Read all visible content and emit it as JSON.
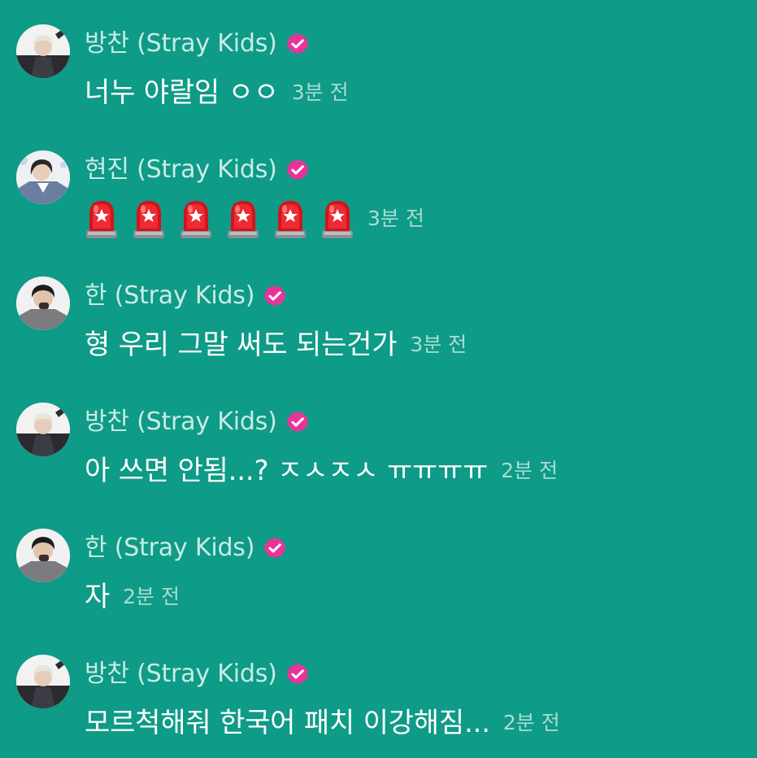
{
  "messages": [
    {
      "author": "방찬 (Stray Kids)",
      "avatar_icon": "user-avatar-bangchan",
      "badge_icon": "verified-badge-icon",
      "text": "너누 야랄임 ㅇㅇ",
      "time": "3분 전"
    },
    {
      "author": "현진 (Stray Kids)",
      "avatar_icon": "user-avatar-hyunjin",
      "badge_icon": "verified-badge-icon",
      "emoji_icon": "police-siren-emoji",
      "emoji_count": 6,
      "time": "3분 전"
    },
    {
      "author": "한 (Stray Kids)",
      "avatar_icon": "user-avatar-han",
      "badge_icon": "verified-badge-icon",
      "text": "형 우리 그말 써도 되는건가",
      "time": "3분 전"
    },
    {
      "author": "방찬 (Stray Kids)",
      "avatar_icon": "user-avatar-bangchan",
      "badge_icon": "verified-badge-icon",
      "text": "아 쓰면 안됨...? ㅈㅅㅈㅅ ㅠㅠㅠㅠ",
      "time": "2분 전"
    },
    {
      "author": "한 (Stray Kids)",
      "avatar_icon": "user-avatar-han",
      "badge_icon": "verified-badge-icon",
      "text": "자",
      "time": "2분 전"
    },
    {
      "author": "방찬 (Stray Kids)",
      "avatar_icon": "user-avatar-bangchan",
      "badge_icon": "verified-badge-icon",
      "text": "모르척해줘 한국어 패치 이강해짐...",
      "time": "2분 전"
    }
  ],
  "colors": {
    "background": "#0e9b87",
    "name_text": "#c9ece4",
    "message_text": "#ffffff",
    "time_text": "#a9ddd2",
    "badge": "#e8349a"
  }
}
